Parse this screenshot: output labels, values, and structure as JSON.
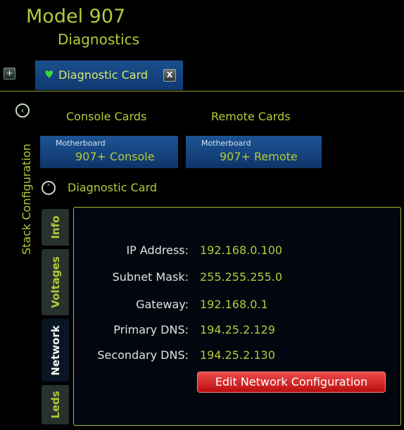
{
  "header": {
    "title": "Model 907",
    "subtitle": "Diagnostics"
  },
  "tabbar": {
    "add_icon": "+",
    "tab_label": "Diagnostic Card",
    "close_icon": "X"
  },
  "stack": {
    "label": "Stack Configuration",
    "console_heading": "Console Cards",
    "remote_heading": "Remote Cards",
    "console_card": {
      "small": "Motherboard",
      "name": "907+ Console"
    },
    "remote_card": {
      "small": "Motherboard",
      "name": "907+ Remote"
    },
    "diag_label": "Diagnostic Card"
  },
  "side_tabs": [
    "Info",
    "Voltages",
    "Network",
    "Leds"
  ],
  "network": {
    "rows": [
      {
        "label": "IP Address:",
        "value": "192.168.0.100"
      },
      {
        "label": "Subnet Mask:",
        "value": "255.255.255.0"
      },
      {
        "label": "Gateway:",
        "value": "192.168.0.1"
      },
      {
        "label": "Primary DNS:",
        "value": "194.25.2.129"
      },
      {
        "label": "Secondary DNS:",
        "value": "194.25.2.130"
      }
    ],
    "edit_button": "Edit Network Configuration"
  },
  "colors": {
    "accent": "#b5c93a",
    "tab_blue": "#1b4f8d",
    "button_red": "#d42525"
  }
}
